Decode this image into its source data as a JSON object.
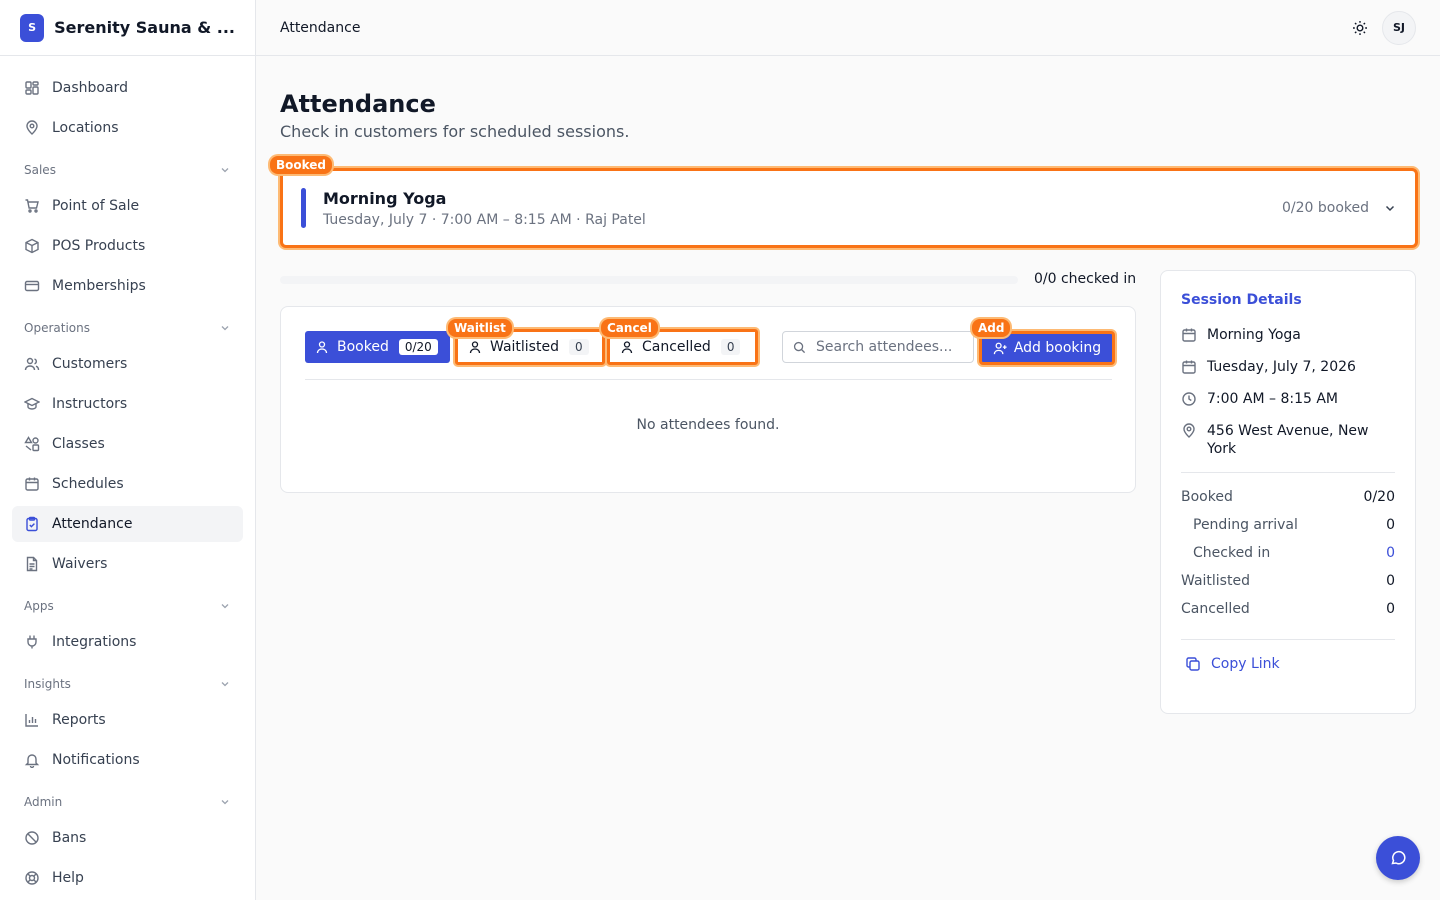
{
  "brand": {
    "initial": "S",
    "name": "Serenity Sauna & ..."
  },
  "nav": {
    "top": [
      {
        "label": "Dashboard",
        "icon": "dashboard-icon"
      },
      {
        "label": "Locations",
        "icon": "map-pin-icon"
      }
    ],
    "sections": [
      {
        "title": "Sales",
        "items": [
          "Point of Sale",
          "POS Products",
          "Memberships"
        ]
      },
      {
        "title": "Operations",
        "items": [
          "Customers",
          "Instructors",
          "Classes",
          "Schedules",
          "Attendance",
          "Waivers"
        ]
      },
      {
        "title": "Apps",
        "items": [
          "Integrations"
        ]
      },
      {
        "title": "Insights",
        "items": [
          "Reports",
          "Notifications"
        ]
      },
      {
        "title": "Admin",
        "items": [
          "Bans",
          "Help"
        ]
      }
    ],
    "active": "Attendance"
  },
  "topbar": {
    "title": "Attendance",
    "avatar_initials": "SJ"
  },
  "page": {
    "title": "Attendance",
    "subtitle": "Check in customers for scheduled sessions."
  },
  "session": {
    "tag": "Booked",
    "title": "Morning Yoga",
    "subtitle": "Tuesday, July 7 · 7:00 AM – 8:15 AM · Raj Patel",
    "booked_summary": "0/20 booked"
  },
  "progress": {
    "fraction": 0,
    "label": "0/0 checked in"
  },
  "tabs": {
    "booked": {
      "label": "Booked",
      "count": "0/20"
    },
    "waitlisted": {
      "label": "Waitlisted",
      "count": "0",
      "tag": "Waitlist"
    },
    "cancelled": {
      "label": "Cancelled",
      "count": "0",
      "tag": "Cancel"
    }
  },
  "search": {
    "placeholder": "Search attendees..."
  },
  "add_booking": {
    "label": "Add booking",
    "tag": "Add"
  },
  "empty_text": "No attendees found.",
  "details": {
    "title": "Session Details",
    "class_name": "Morning Yoga",
    "date": "Tuesday, July 7, 2026",
    "time": "7:00 AM – 8:15 AM",
    "location": "456 West Avenue, New York",
    "stats": {
      "booked_label": "Booked",
      "booked": "0/20",
      "pending_label": "Pending arrival",
      "pending": "0",
      "checked_label": "Checked in",
      "checked": "0",
      "waitlisted_label": "Waitlisted",
      "waitlisted": "0",
      "cancelled_label": "Cancelled",
      "cancelled": "0"
    },
    "copy_link": "Copy Link"
  },
  "colors": {
    "accent": "#3b4fd8",
    "highlight": "#f97316"
  }
}
